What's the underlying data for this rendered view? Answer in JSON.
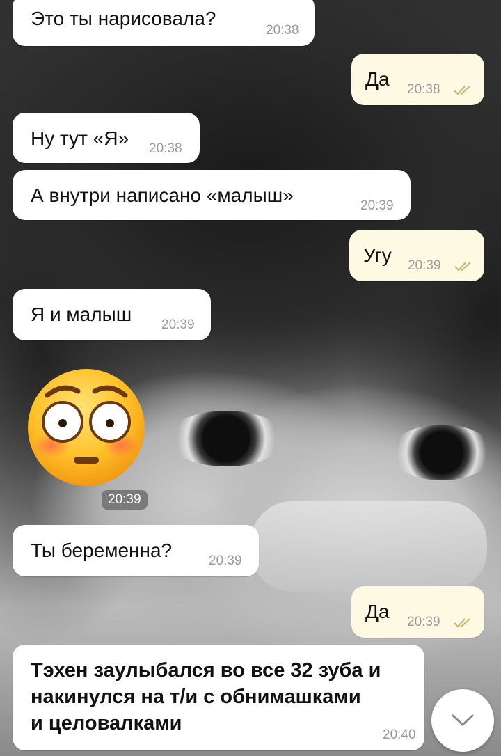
{
  "messages": [
    {
      "id": "m1",
      "dir": "in",
      "text": "Это ты нарисовала?",
      "time": "20:38"
    },
    {
      "id": "m2",
      "dir": "out",
      "text": "Да",
      "time": "20:38",
      "read": true
    },
    {
      "id": "m3",
      "dir": "in",
      "text": "Ну тут «Я»",
      "time": "20:38"
    },
    {
      "id": "m4",
      "dir": "in",
      "text": "А внутри написано «малыш»",
      "time": "20:39"
    },
    {
      "id": "m5",
      "dir": "out",
      "text": "Угу",
      "time": "20:39",
      "read": true
    },
    {
      "id": "m6",
      "dir": "in",
      "text": "Я и малыш",
      "time": "20:39"
    },
    {
      "id": "m7",
      "dir": "in",
      "emoji": "flushed-face",
      "time": "20:39"
    },
    {
      "id": "m8",
      "dir": "in",
      "text": "Ты беременна?",
      "time": "20:39"
    },
    {
      "id": "m9",
      "dir": "out",
      "text": "Да",
      "time": "20:39",
      "read": true
    },
    {
      "id": "m10",
      "dir": "in",
      "text_lines": [
        "Тэхен заулыбался во все 32 зуба и",
        "накинулся на т/и с обнимашками",
        "и целовалками"
      ],
      "time": "20:40"
    }
  ],
  "colors": {
    "incoming_bubble": "#ffffff",
    "outgoing_bubble": "#fdf9e3",
    "time_text": "#9a9a9a",
    "read_check": "#c9b46a"
  },
  "icons": {
    "read_receipt": "double-check-icon",
    "scroll_down": "chevron-down-icon"
  }
}
